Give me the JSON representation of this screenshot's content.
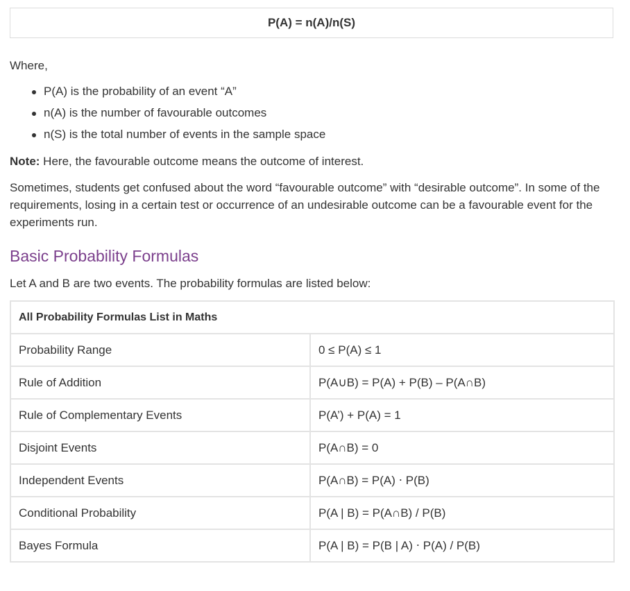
{
  "formula_box": {
    "text": "P(A) = n(A)/n(S)"
  },
  "where_label": "Where,",
  "definitions": [
    "P(A) is the probability of an event “A”",
    "n(A) is the number of favourable outcomes",
    "n(S) is the total number of events in the sample space"
  ],
  "note": {
    "label": "Note:",
    "text": " Here, the favourable outcome means the outcome of interest."
  },
  "paragraph": "Sometimes, students get confused about the word “favourable outcome” with “desirable outcome”. In some of the requirements, losing in a certain test or occurrence of an undesirable outcome can be a favourable event for the experiments run.",
  "section_heading": "Basic Probability Formulas",
  "intro": "Let A and B are two events. The probability formulas are listed below:",
  "table": {
    "header": "All Probability Formulas List in Maths",
    "rows": [
      {
        "name": "Probability Range",
        "formula": "0 ≤ P(A) ≤ 1"
      },
      {
        "name": "Rule of Addition",
        "formula": "P(A∪B) = P(A) + P(B) – P(A∩B)"
      },
      {
        "name": "Rule of Complementary Events",
        "formula": "P(A’) + P(A) = 1"
      },
      {
        "name": "Disjoint Events",
        "formula": "P(A∩B) = 0"
      },
      {
        "name": "Independent Events",
        "formula": "P(A∩B) = P(A) ⋅ P(B)"
      },
      {
        "name": "Conditional Probability",
        "formula": "P(A | B) = P(A∩B) / P(B)"
      },
      {
        "name": "Bayes Formula",
        "formula": "P(A | B) = P(B | A) ⋅ P(A) / P(B)"
      }
    ]
  },
  "colors": {
    "heading": "#7b3f8c",
    "text": "#333333",
    "border": "#e3e3e3"
  }
}
